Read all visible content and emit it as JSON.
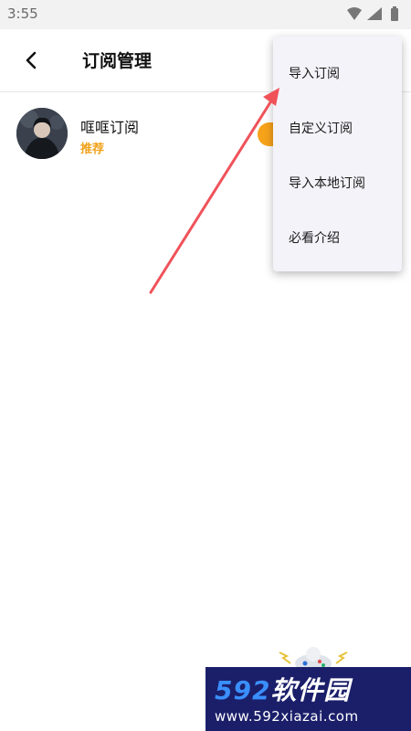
{
  "status_bar": {
    "time": "3:55",
    "icons": [
      "wifi-icon",
      "signal-icon",
      "battery-icon"
    ]
  },
  "app_bar": {
    "back_icon": "back-arrow-icon",
    "title": "订阅管理"
  },
  "subscriptions": [
    {
      "name": "哐哐订阅",
      "tag": "推荐"
    }
  ],
  "menu": {
    "items": [
      {
        "label": "导入订阅"
      },
      {
        "label": "自定义订阅"
      },
      {
        "label": "导入本地订阅"
      },
      {
        "label": "必看介绍"
      }
    ]
  },
  "watermark": {
    "digits": "592",
    "name": "软件园",
    "url": "www.592xiazai.com"
  },
  "colors": {
    "accent": "#f7a21b",
    "tag": "#f0a21a",
    "arrow": "#f0525a",
    "menu_bg": "#f4f3f9"
  }
}
